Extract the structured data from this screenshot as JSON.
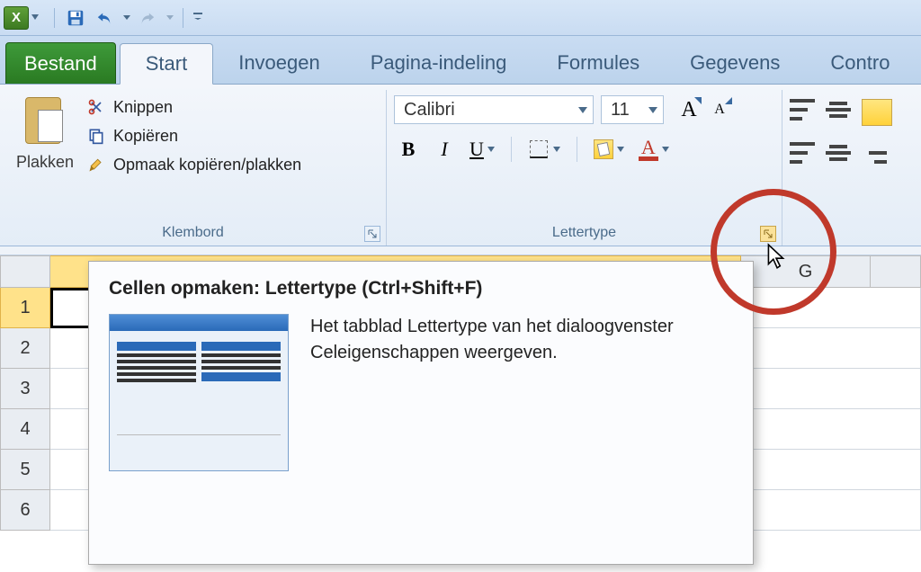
{
  "qat": {
    "app_letter": "X"
  },
  "tabs": {
    "file": "Bestand",
    "items": [
      "Start",
      "Invoegen",
      "Pagina-indeling",
      "Formules",
      "Gegevens",
      "Contro"
    ],
    "active_index": 0
  },
  "clipboard": {
    "paste": "Plakken",
    "cut": "Knippen",
    "copy": "Kopiëren",
    "format_painter": "Opmaak kopiëren/plakken",
    "group_label": "Klembord"
  },
  "font": {
    "name": "Calibri",
    "size": "11",
    "group_label": "Lettertype",
    "bold": "B",
    "italic": "I",
    "underline": "U",
    "grow_label": "A",
    "shrink_label": "A",
    "font_color_letter": "A"
  },
  "columns": {
    "g": "G"
  },
  "rows": [
    "1",
    "2",
    "3",
    "4",
    "5",
    "6"
  ],
  "tooltip": {
    "title": "Cellen opmaken: Lettertype (Ctrl+Shift+F)",
    "desc": "Het tabblad Lettertype van het dialoogvenster Celeigenschappen weergeven."
  }
}
